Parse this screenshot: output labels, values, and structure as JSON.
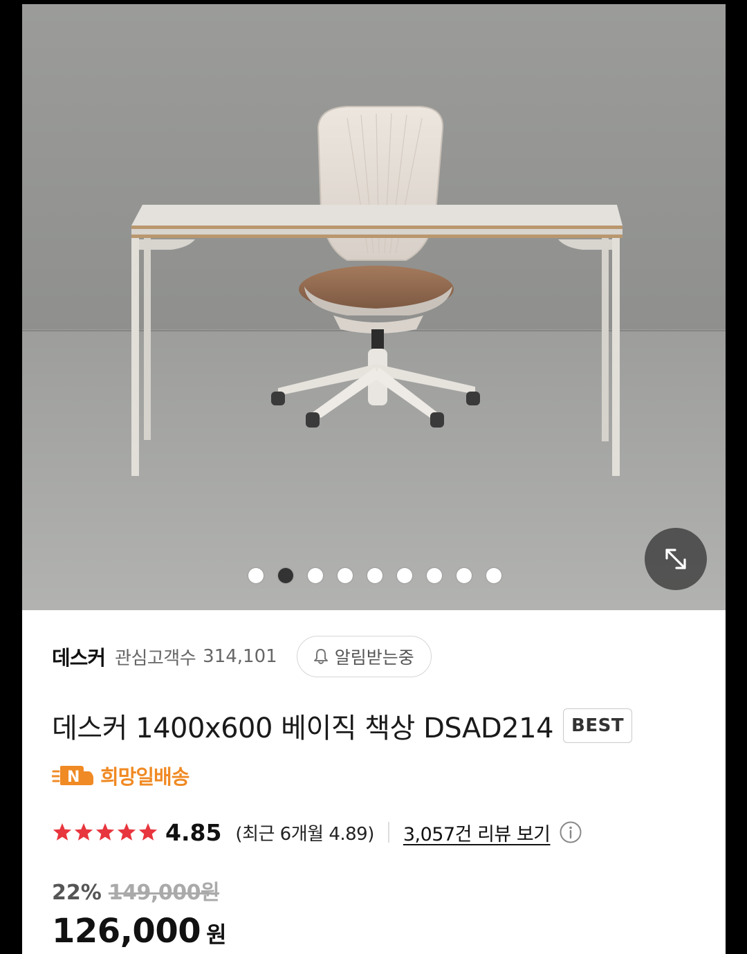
{
  "gallery": {
    "image_description": "",
    "dot_count": 9,
    "active_index": 1,
    "expand_icon": "expand-diagonal-icon"
  },
  "store": {
    "name": "데스커",
    "follower_label": "관심고객수",
    "follower_count": "314,101",
    "alarm_label": "알림받는중",
    "alarm_icon": "bell-icon"
  },
  "product": {
    "title": "데스커 1400x600 베이직 책상 DSAD214",
    "badge": "BEST",
    "delivery_label": "희망일배송",
    "delivery_icon": "n-delivery-truck-icon"
  },
  "rating": {
    "stars": 5,
    "score": "4.85",
    "recent": "(최근 6개월 4.89)",
    "review_link": "3,057건 리뷰 보기",
    "star_color": "#e8363e"
  },
  "price": {
    "discount_rate": "22%",
    "original": "149,000원",
    "current": "126,000",
    "currency": "원"
  },
  "colors": {
    "accent_orange": "#f08a24",
    "star_red": "#e8363e"
  }
}
